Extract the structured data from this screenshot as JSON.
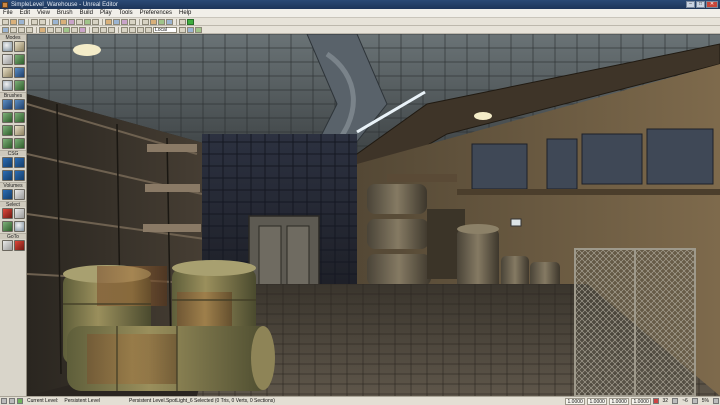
{
  "window": {
    "title": "SimpleLevel_Warehouse - Unreal Editor"
  },
  "menu": {
    "items": [
      "File",
      "Edit",
      "View",
      "Brush",
      "Build",
      "Play",
      "Tools",
      "Preferences",
      "Help"
    ]
  },
  "toolbar": {
    "coordinate_system": "Local"
  },
  "modes_panel": {
    "title": "Modes",
    "sections": {
      "brushes": "Brushes",
      "csg": "CSG",
      "volumes": "Volumes",
      "select": "Select",
      "goto": "GoTo"
    }
  },
  "statusbar": {
    "current_level_label": "Current Level:",
    "current_level_value": "Persistent Level",
    "selection_info": "Persistent Level.SpotLight_6 Selected (0 Tris, 0 Verts, 0 Sections)",
    "scale_x": "1.0000",
    "scale_y": "1.0000",
    "scale_z": "1.0000",
    "drag_scale": "1.0000",
    "grid_size": "32",
    "rotation_snap": "~6",
    "scale_snap": "5%"
  },
  "colors": {
    "title_bar": "#1d3559",
    "panel_bg": "#d9d5ca",
    "menu_bg": "#f1efe9"
  }
}
